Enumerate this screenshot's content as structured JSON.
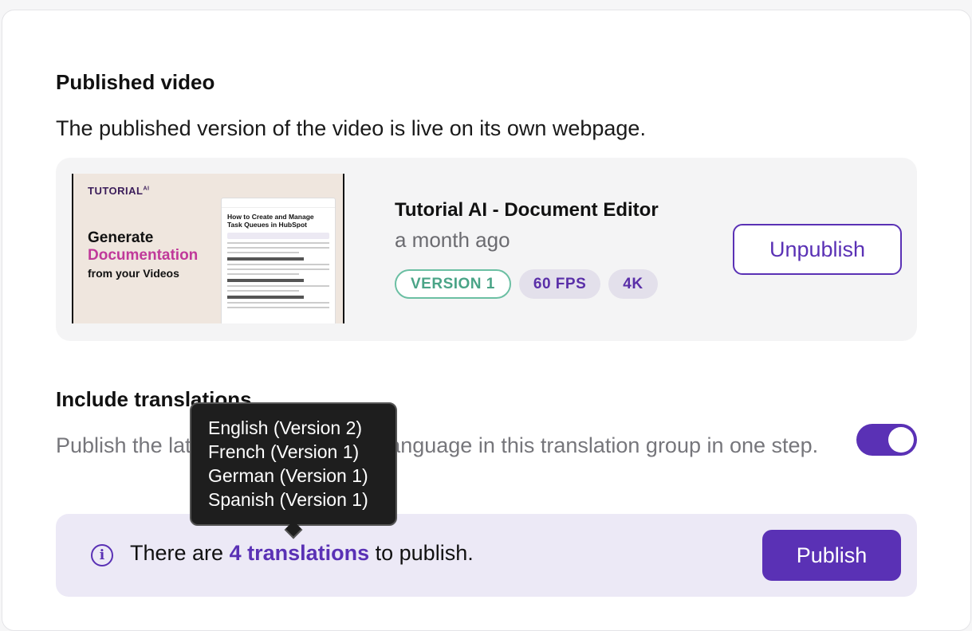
{
  "published": {
    "title": "Published video",
    "description": "The published version of the video is live on its own webpage."
  },
  "video": {
    "title": "Tutorial AI - Document Editor",
    "age": "a month ago",
    "badges": [
      "VERSION 1",
      "60 FPS",
      "4K"
    ],
    "unpublish_label": "Unpublish",
    "thumbnail": {
      "brand": "TUTORIAL",
      "brand_sup": "AI",
      "hero_line1": "Generate",
      "hero_line2": "Documentation",
      "hero_line3": "from your Videos",
      "doc_heading": "How to Create and Manage Task Queues in HubSpot"
    }
  },
  "translations": {
    "title": "Include translations",
    "description": "Publish the latest version of every language in this translation group in one step.",
    "toggle_on": true,
    "info_prefix": "There are ",
    "info_link": "4 translations",
    "info_suffix": " to publish.",
    "publish_label": "Publish",
    "tooltip_items": [
      "English (Version 2)",
      "French (Version 1)",
      "German (Version 1)",
      "Spanish (Version 1)"
    ]
  },
  "colors": {
    "accent": "#5a31b5",
    "version_badge": "#4aa487",
    "panel_bg": "#f4f4f5",
    "info_bg": "#ece9f6"
  },
  "icons": [
    "info-icon"
  ]
}
